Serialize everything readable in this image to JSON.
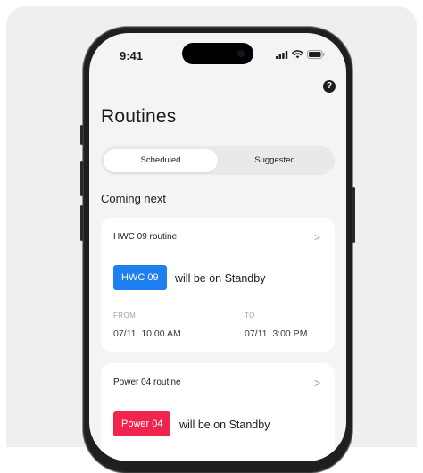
{
  "status_bar": {
    "time": "9:41"
  },
  "page": {
    "title": "Routines",
    "help_label": "?"
  },
  "tabs": [
    {
      "label": "Scheduled",
      "active": true
    },
    {
      "label": "Suggested",
      "active": false
    }
  ],
  "section": {
    "title": "Coming next"
  },
  "routines": [
    {
      "name": "HWC 09 routine",
      "device": "HWC 09",
      "device_color": "#1e7ff0",
      "status_text": "will be on Standby",
      "from_label": "FROM",
      "from_value": "07/11  10:00 AM",
      "to_label": "TO",
      "to_value": "07/11  3:00 PM"
    },
    {
      "name": "Power 04 routine",
      "device": "Power 04",
      "device_color": "#f0244f",
      "status_text": "will be on Standby"
    }
  ]
}
